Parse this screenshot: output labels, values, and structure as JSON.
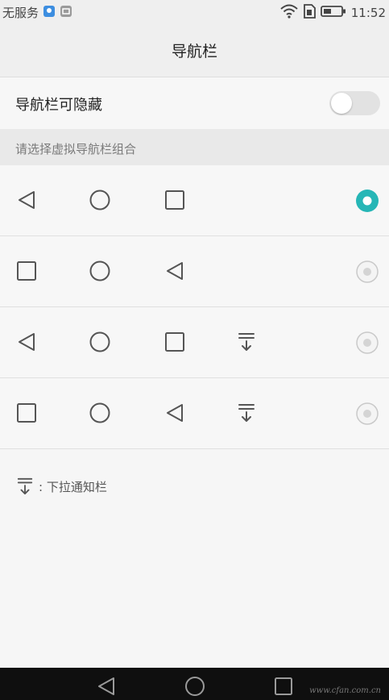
{
  "status_bar": {
    "carrier": "无服务",
    "time": "11:52",
    "icons": [
      "notification-app-icon",
      "notification-image-icon",
      "wifi-icon",
      "sim-icon",
      "battery-icon"
    ]
  },
  "app_bar": {
    "title": "导航栏"
  },
  "hide_setting": {
    "label": "导航栏可隐藏",
    "enabled": false
  },
  "section": {
    "title": "请选择虚拟导航栏组合"
  },
  "options": [
    {
      "buttons": [
        "back",
        "home",
        "recent"
      ],
      "selected": true
    },
    {
      "buttons": [
        "recent",
        "home",
        "back"
      ],
      "selected": false
    },
    {
      "buttons": [
        "back",
        "home",
        "recent",
        "notification"
      ],
      "selected": false
    },
    {
      "buttons": [
        "recent",
        "home",
        "back",
        "notification"
      ],
      "selected": false
    }
  ],
  "legend": {
    "text": ": 下拉通知栏",
    "icon": "pull-down-notification-icon"
  },
  "colors": {
    "accent": "#26b6b6",
    "background": "#f6f6f6",
    "nav_bar": "#0f0f0f"
  },
  "watermark": "www.cfan.com.cn"
}
